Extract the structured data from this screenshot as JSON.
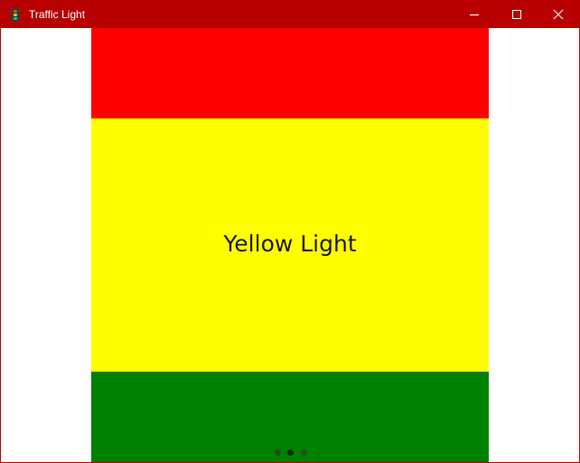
{
  "window": {
    "title": "Traffic Light",
    "title_bar_color": "#b80000",
    "icons": {
      "app": "traffic-light-icon",
      "minimize": "minimize-icon",
      "maximize": "maximize-icon",
      "close": "close-icon"
    }
  },
  "lights": [
    {
      "name": "red",
      "color": "#ff0000"
    },
    {
      "name": "yellow",
      "color": "#ffff00",
      "label": "Yellow Light"
    },
    {
      "name": "green",
      "color": "#008000"
    }
  ],
  "pager": {
    "page_count": 3,
    "current_page": 2,
    "dot_color": "#1f4f1f",
    "active_dot_color": "#0d2a0d"
  }
}
